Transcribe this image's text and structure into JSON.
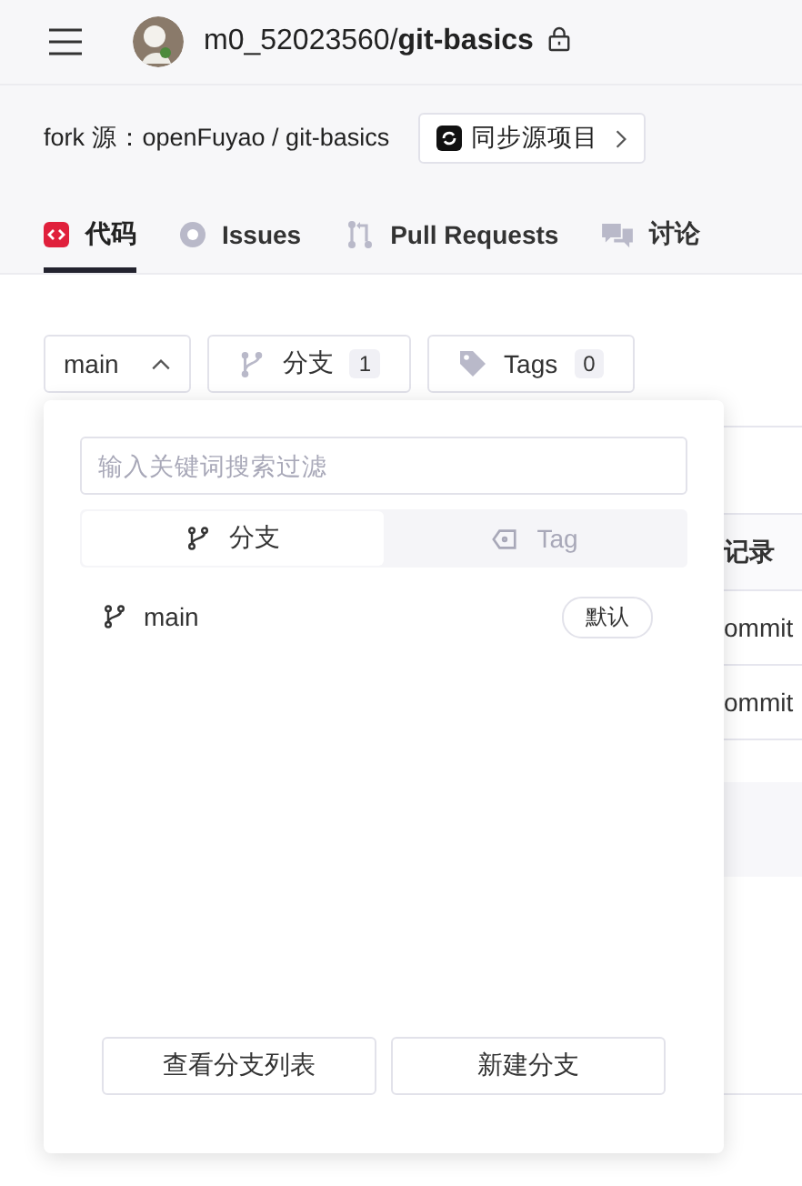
{
  "header": {
    "owner": "m0_52023560/",
    "repo": "git-basics",
    "private": true
  },
  "fork": {
    "label": "fork 源：openFuyao / git-basics",
    "sync_button": "同步源项目"
  },
  "tabs": [
    {
      "label": "代码",
      "kind": "code",
      "selected": true
    },
    {
      "label": "Issues",
      "kind": "issues",
      "selected": false
    },
    {
      "label": "Pull Requests",
      "kind": "pulls",
      "selected": false
    },
    {
      "label": "讨论",
      "kind": "discuss",
      "selected": false
    }
  ],
  "toolbar": {
    "branch_select": "main",
    "expanded": true,
    "branches": {
      "label": "分支",
      "count": "1"
    },
    "tags": {
      "label": "Tags",
      "count": "0"
    }
  },
  "background_table": {
    "column_3_header": "记录",
    "rows": [
      "ommit",
      "ommit"
    ]
  },
  "branch_popover": {
    "search": {
      "placeholder": "输入关键词搜索过滤"
    },
    "switch": [
      {
        "label": "分支",
        "kind": "branch",
        "selected": true
      },
      {
        "label": "Tag",
        "kind": "tag",
        "selected": false
      }
    ],
    "items": [
      {
        "name": "main",
        "badge": "默认"
      }
    ],
    "buttons": [
      "查看分支列表",
      "新建分支"
    ]
  }
}
